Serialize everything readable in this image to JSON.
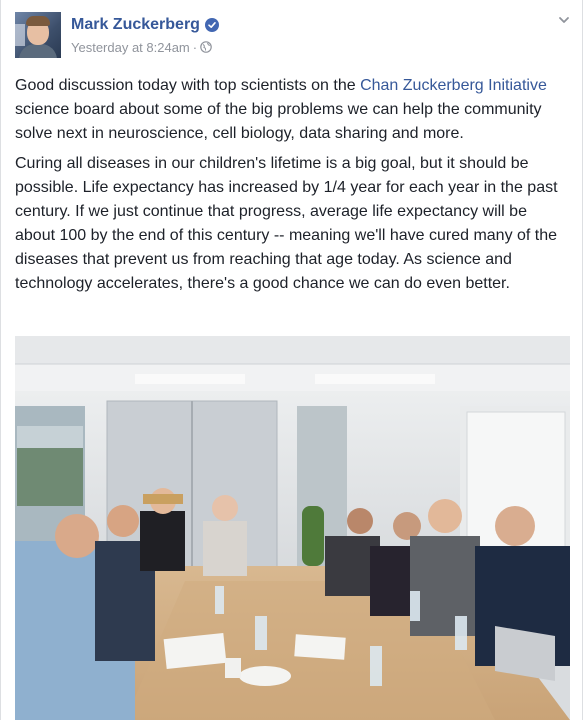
{
  "post": {
    "author": "Mark Zuckerberg",
    "timestamp": "Yesterday at 8:24am",
    "separator": "·",
    "audience_icon": "globe-icon",
    "verified_icon": "verified-badge-icon",
    "options_icon": "chevron-down-icon",
    "paragraph1": {
      "before_link": "Good discussion today with top scientists on the ",
      "link_text": "Chan Zuckerberg Initiative",
      "after_link": " science board about some of the big problems we can help the community solve next in neuroscience, cell biology, data sharing and more."
    },
    "paragraph2": "Curing all diseases in our children's lifetime is a big goal, but it should be possible. Life expectancy has increased by 1/4 year for each year in the past century. If we just continue that progress, average life expectancy will be about 100 by the end of this century -- meaning we'll have cured many of the diseases that prevent us from reaching that age today. As science and technology accelerates, there's a good chance we can do even better."
  },
  "colors": {
    "link": "#365899",
    "text": "#1d2129",
    "meta": "#90949c",
    "verified": "#4267b2"
  }
}
